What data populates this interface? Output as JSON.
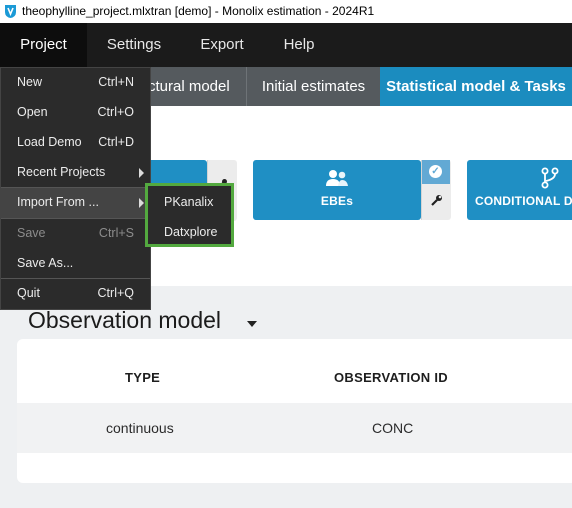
{
  "window": {
    "title": "theophylline_project.mlxtran [demo]  - Monolix estimation - 2024R1"
  },
  "menubar": {
    "items": [
      "Project",
      "Settings",
      "Export",
      "Help"
    ],
    "active": "Project"
  },
  "tabs": {
    "items": [
      "ctural model",
      "Initial estimates",
      "Statistical model & Tasks"
    ],
    "active": "Statistical model & Tasks"
  },
  "tasks": {
    "ebes_label": "EBEs",
    "conditional_label": "CONDITIONAL DI"
  },
  "project_menu": {
    "items": [
      {
        "label": "New",
        "shortcut": "Ctrl+N"
      },
      {
        "label": "Open",
        "shortcut": "Ctrl+O"
      },
      {
        "label": "Load Demo",
        "shortcut": "Ctrl+D"
      },
      {
        "label": "Recent Projects",
        "shortcut": ""
      },
      {
        "label": "Import From ...",
        "shortcut": ""
      },
      {
        "label": "Save",
        "shortcut": "Ctrl+S"
      },
      {
        "label": "Save As...",
        "shortcut": ""
      },
      {
        "label": "Quit",
        "shortcut": "Ctrl+Q"
      }
    ],
    "import_submenu": [
      "PKanalix",
      "Datxplore"
    ]
  },
  "observation_model": {
    "title": "Observation model",
    "columns": [
      "TYPE",
      "OBSERVATION ID"
    ],
    "rows": [
      [
        "continuous",
        "CONC"
      ]
    ]
  },
  "colors": {
    "accent": "#1b8cbf",
    "highlight": "#53a93f",
    "menubar": "#1b1b1b"
  }
}
